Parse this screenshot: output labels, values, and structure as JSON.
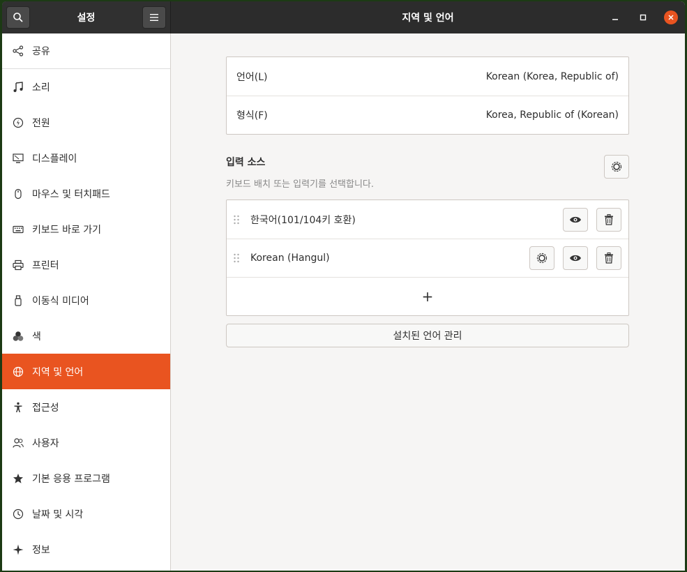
{
  "header": {
    "sidebar_title": "설정",
    "title": "지역 및 언어"
  },
  "sidebar": {
    "items": [
      {
        "label": "공유",
        "icon": "share-icon"
      },
      {
        "label": "소리",
        "icon": "music-note-icon"
      },
      {
        "label": "전원",
        "icon": "power-icon"
      },
      {
        "label": "디스플레이",
        "icon": "display-icon"
      },
      {
        "label": "마우스 및 터치패드",
        "icon": "mouse-icon"
      },
      {
        "label": "키보드 바로 가기",
        "icon": "keyboard-icon"
      },
      {
        "label": "프린터",
        "icon": "printer-icon"
      },
      {
        "label": "이동식 미디어",
        "icon": "usb-icon"
      },
      {
        "label": "색",
        "icon": "color-icon"
      },
      {
        "label": "지역 및 언어",
        "icon": "globe-icon",
        "active": true
      },
      {
        "label": "접근성",
        "icon": "accessibility-icon"
      },
      {
        "label": "사용자",
        "icon": "users-icon"
      },
      {
        "label": "기본 응용 프로그램",
        "icon": "star-icon"
      },
      {
        "label": "날짜 및 시각",
        "icon": "clock-icon"
      },
      {
        "label": "정보",
        "icon": "sparkle-icon"
      }
    ]
  },
  "language": {
    "language_label": "언어(L)",
    "language_value": "Korean (Korea, Republic of)",
    "formats_label": "형식(F)",
    "formats_value": "Korea, Republic of (Korean)"
  },
  "input_sources": {
    "title": "입력 소스",
    "subtitle": "키보드 배치 또는 입력기를 선택합니다.",
    "items": [
      {
        "label": "한국어(101/104키 호환)"
      },
      {
        "label": "Korean (Hangul)"
      }
    ],
    "add_label": "+"
  },
  "manage_button": "설치된 언어 관리",
  "colors": {
    "accent": "#e95420",
    "header": "#2c2c2c"
  }
}
